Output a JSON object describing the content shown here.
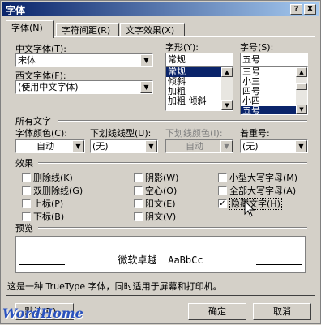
{
  "window": {
    "title": "字体",
    "help_btn": "?",
    "close_btn": "X"
  },
  "tabs": [
    {
      "label": "字体(N)"
    },
    {
      "label": "字符间距(R)"
    },
    {
      "label": "文字效果(X)"
    }
  ],
  "font": {
    "chinese_label": "中文字体(T):",
    "chinese_value": "宋体",
    "western_label": "西文字体(F):",
    "western_value": "(使用中文字体)",
    "style_label": "字形(Y):",
    "style_value": "常规",
    "style_list": [
      "常规",
      "倾斜",
      "加粗",
      "加粗 倾斜"
    ],
    "size_label": "字号(S):",
    "size_value": "五号",
    "size_list": [
      "三号",
      "小三",
      "四号",
      "小四",
      "五号"
    ]
  },
  "all_text": {
    "section_label": "所有文字",
    "color_label": "字体颜色(C):",
    "color_value": "自动",
    "underline_label": "下划线线型(U):",
    "underline_value": "(无)",
    "underline_color_label": "下划线颜色(I):",
    "underline_color_value": "自动",
    "emphasis_label": "着重号:",
    "emphasis_value": "(无)"
  },
  "effects": {
    "section_label": "效果",
    "col1": [
      {
        "label": "删除线(K)",
        "checked": false
      },
      {
        "label": "双删除线(G)",
        "checked": false
      },
      {
        "label": "上标(P)",
        "checked": false
      },
      {
        "label": "下标(B)",
        "checked": false
      }
    ],
    "col2": [
      {
        "label": "阴影(W)",
        "checked": false
      },
      {
        "label": "空心(O)",
        "checked": false
      },
      {
        "label": "阳文(E)",
        "checked": false
      },
      {
        "label": "阴文(V)",
        "checked": false
      }
    ],
    "col3": [
      {
        "label": "小型大写字母(M)",
        "checked": false
      },
      {
        "label": "全部大写字母(A)",
        "checked": false
      },
      {
        "label": "隐藏文字(H)",
        "checked": true
      }
    ]
  },
  "preview": {
    "section_label": "预览",
    "sample_cn": "微软卓越",
    "sample_en": "AaBbCc",
    "note": "这是一种 TrueType 字体，同时适用于屏幕和打印机。"
  },
  "buttons": {
    "default": "默认(D)...",
    "ok": "确定",
    "cancel": "取消"
  },
  "watermark": "WordHome",
  "colors": {
    "titlebar": "#0a246a",
    "dialog_bg": "#d4d0c8",
    "selection": "#0a246a"
  }
}
